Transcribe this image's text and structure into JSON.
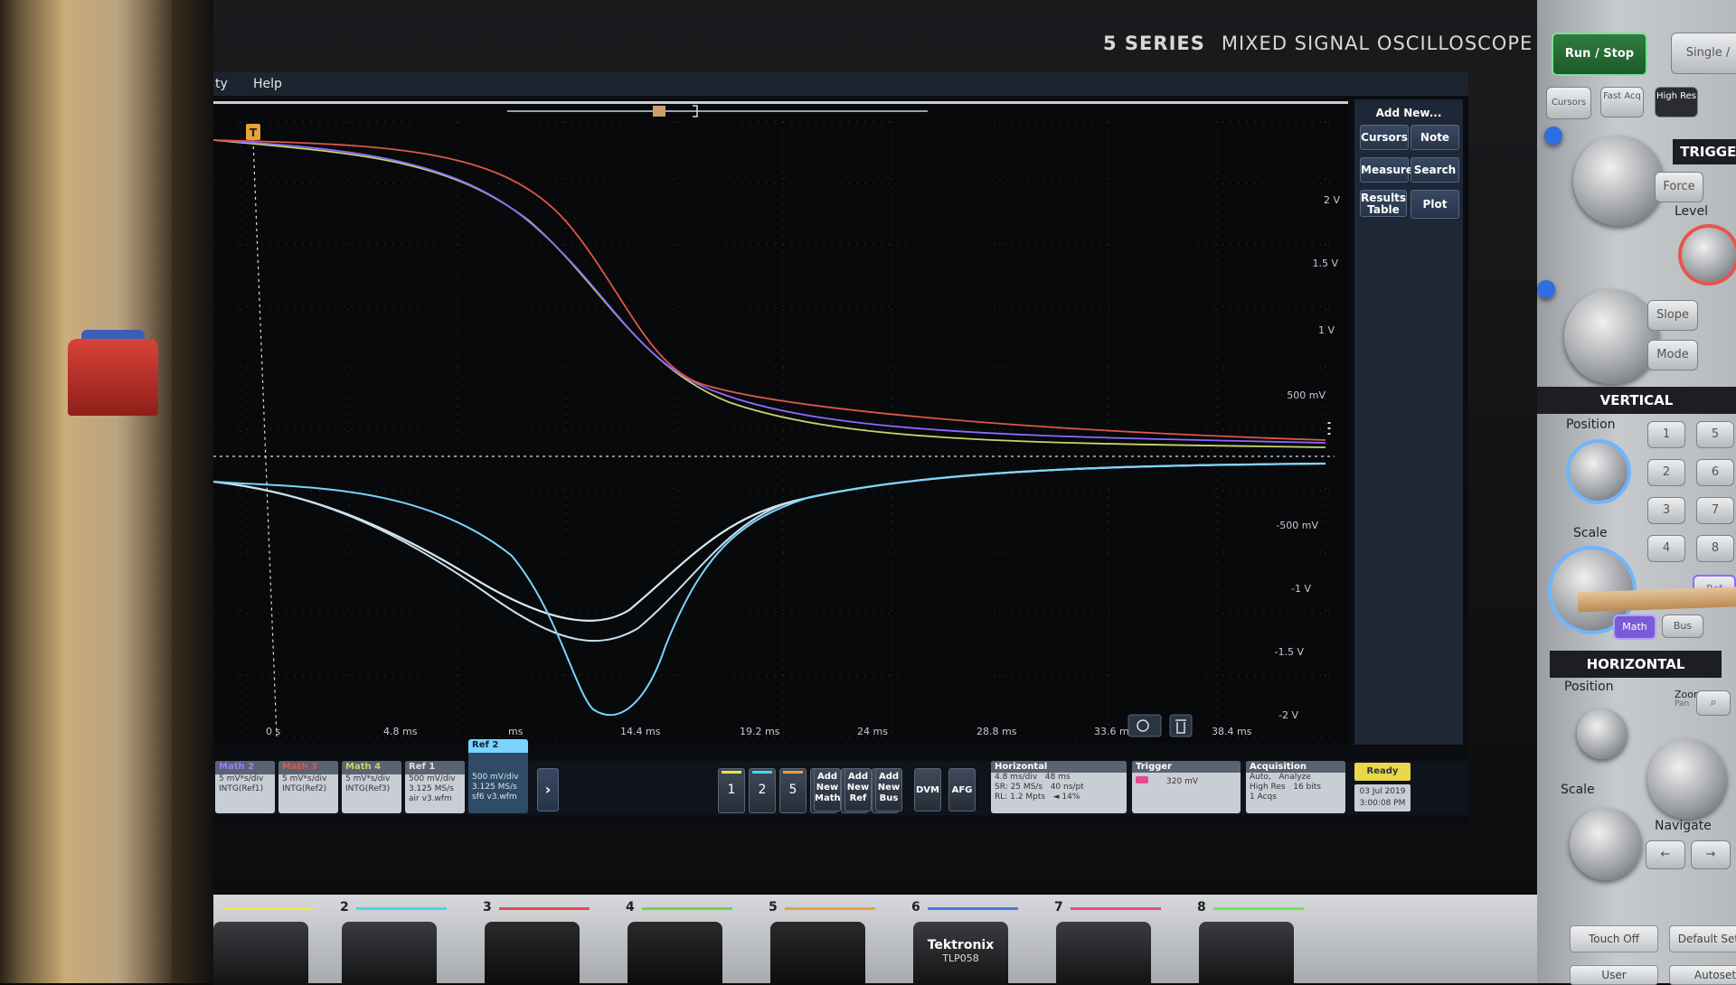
{
  "brand": {
    "series": "5 SERIES",
    "model": "MIXED SIGNAL OSCILLOSCOPE"
  },
  "menu": {
    "item_partial": "ty",
    "help": "Help"
  },
  "trigger_marker": "T",
  "right_menu": {
    "add_new": "Add New...",
    "cursors": "Cursors",
    "note": "Note",
    "measure": "Measure",
    "search": "Search",
    "results_table_1": "Results",
    "results_table_2": "Table",
    "plot": "Plot"
  },
  "y_labels": [
    "2 V",
    "1.5 V",
    "1 V",
    "500 mV",
    "-500 mV",
    "-1 V",
    "-1.5 V",
    "-2 V"
  ],
  "x_labels": [
    "0 s",
    "4.8 ms",
    "ms",
    "14.4 ms",
    "19.2 ms",
    "24 ms",
    "28.8 ms",
    "33.6 ms",
    "38.4 ms"
  ],
  "badges": [
    {
      "title": "Math 2",
      "l1": "5 mV*s/div",
      "l2": "INTG(Ref1)",
      "l3": "",
      "color": "#9a7cff"
    },
    {
      "title": "Math 3",
      "l1": "5 mV*s/div",
      "l2": "INTG(Ref2)",
      "l3": "",
      "color": "#e0564a"
    },
    {
      "title": "Math 4",
      "l1": "5 mV*s/div",
      "l2": "INTG(Ref3)",
      "l3": "",
      "color": "#c9d46a"
    },
    {
      "title": "Ref 1",
      "l1": "500 mV/div",
      "l2": "3.125 MS/s",
      "l3": "air v3.wfm",
      "color": "#e0e0e0"
    },
    {
      "title": "Ref 2",
      "l1": "500 mV/div",
      "l2": "3.125 MS/s",
      "l3": "sf6 v3.wfm",
      "color": "#7ad4ff"
    }
  ],
  "channel_buttons": [
    {
      "label": "1",
      "color": "#f2e14a"
    },
    {
      "label": "2",
      "color": "#4ad6e8"
    },
    {
      "label": "5",
      "color": "#e8a23a"
    },
    {
      "label": "6",
      "color": "#4a76e8"
    },
    {
      "label": "7",
      "color": "#e84a8f"
    },
    {
      "label": "8",
      "color": "#6fe84a"
    }
  ],
  "add_buttons": [
    {
      "l1": "Add",
      "l2": "New",
      "l3": "Math"
    },
    {
      "l1": "Add",
      "l2": "New",
      "l3": "Ref"
    },
    {
      "l1": "Add",
      "l2": "New",
      "l3": "Bus"
    }
  ],
  "dvm": "DVM",
  "afg": "AFG",
  "horizontal": {
    "title": "Horizontal",
    "l1a": "4.8 ms/div",
    "l1b": "48 ms",
    "l2a": "SR: 25 MS/s",
    "l2b": "40 ns/pt",
    "l3a": "RL: 1.2 Mpts",
    "l3b": "◄ 14%"
  },
  "trigger": {
    "title": "Trigger",
    "value": "320 mV"
  },
  "acquisition": {
    "title": "Acquisition",
    "l1a": "Auto,",
    "l1b": "Analyze",
    "l2a": "High Res",
    "l2b": "16 bits",
    "l3": "1 Acqs"
  },
  "status": {
    "ready": "Ready",
    "date": "03 Jul 2019",
    "time": "3:00:08 PM"
  },
  "panel": {
    "run_stop": "Run / Stop",
    "single": "Single /",
    "cursors": "Cursors",
    "fast_acq": "Fast Acq",
    "high_res": "High Res",
    "trigger_hdr": "TRIGGER",
    "force": "Force",
    "level": "Level",
    "slope": "Slope",
    "mode": "Mode",
    "vertical_hdr": "VERTICAL",
    "position": "Position",
    "scale": "Scale",
    "vbtns": [
      "1",
      "5",
      "2",
      "6",
      "3",
      "7",
      "4",
      "8"
    ],
    "ref": "Ref",
    "math": "Math",
    "bus": "Bus",
    "horizontal_hdr": "HORIZONTAL",
    "h_position": "Position",
    "h_scale": "Scale",
    "zoom": "Zoom",
    "pan": "Pan",
    "navigate": "Navigate"
  },
  "bottom": {
    "channels": [
      {
        "num": "2",
        "color": "#4ad6e8"
      },
      {
        "num": "3",
        "color": "#e8484a"
      },
      {
        "num": "4",
        "color": "#6fd64a"
      },
      {
        "num": "5",
        "color": "#e8a23a"
      },
      {
        "num": "6",
        "color": "#4a76e8"
      },
      {
        "num": "7",
        "color": "#e84a8f"
      },
      {
        "num": "8",
        "color": "#6fe84a"
      }
    ],
    "probe_brand": "Tektronix",
    "probe_model": "TLP058",
    "touch_off": "Touch Off",
    "default_setup": "Default Setup",
    "user": "User",
    "autoset": "Autoset"
  }
}
